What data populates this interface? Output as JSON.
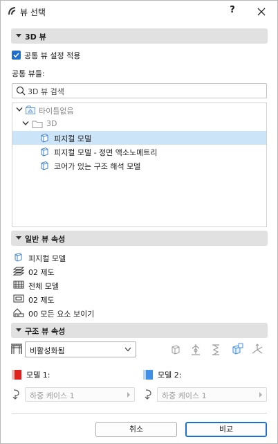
{
  "window": {
    "title": "뷰 선택",
    "help_label": "?"
  },
  "section_3d": {
    "label": "3D 뷰"
  },
  "apply_common": {
    "label": "공통 뷰 설정 적용",
    "checked": true
  },
  "common_views_label": "공통 뷰들:",
  "search": {
    "placeholder": "3D 뷰 검색"
  },
  "tree": {
    "root": {
      "label": "타이틀없음",
      "icon": "project-icon"
    },
    "folder": {
      "label": "3D",
      "icon": "folder-icon"
    },
    "items": [
      {
        "label": "피지컬 모델",
        "icon": "cube-icon",
        "selected": true
      },
      {
        "label": "피지컬 모델 - 정면 액소노메트리",
        "icon": "cube-icon",
        "selected": false
      },
      {
        "label": "코어가 있는 구조 해석 모델",
        "icon": "cube-icon",
        "selected": false
      }
    ]
  },
  "section_general": {
    "label": "일반 뷰 속성"
  },
  "general_props": [
    {
      "label": "피지컬 모델",
      "icon": "model-icon"
    },
    {
      "label": "02 제도",
      "icon": "layer-icon"
    },
    {
      "label": "전체 모델",
      "icon": "model-filter-icon"
    },
    {
      "label": "02 제도",
      "icon": "graphic-override-icon"
    },
    {
      "label": "00 모든 요소 보이기",
      "icon": "renovation-icon"
    }
  ],
  "section_structural": {
    "label": "구조 뷰 속성"
  },
  "structural": {
    "mode_value": "비활성화됨",
    "model1": {
      "label": "모델 1:",
      "color": "#e0201b",
      "loadcase": "하중 케이스 1"
    },
    "model2": {
      "label": "모델 2:",
      "color": "#3f8ee8",
      "loadcase": "하중 케이스 1"
    }
  },
  "buttons": {
    "cancel": "취소",
    "compare": "비교"
  },
  "colors": {
    "accent": "#1f6fd1",
    "selection": "#cce4f7",
    "section_bg": "#e1e1e1"
  }
}
